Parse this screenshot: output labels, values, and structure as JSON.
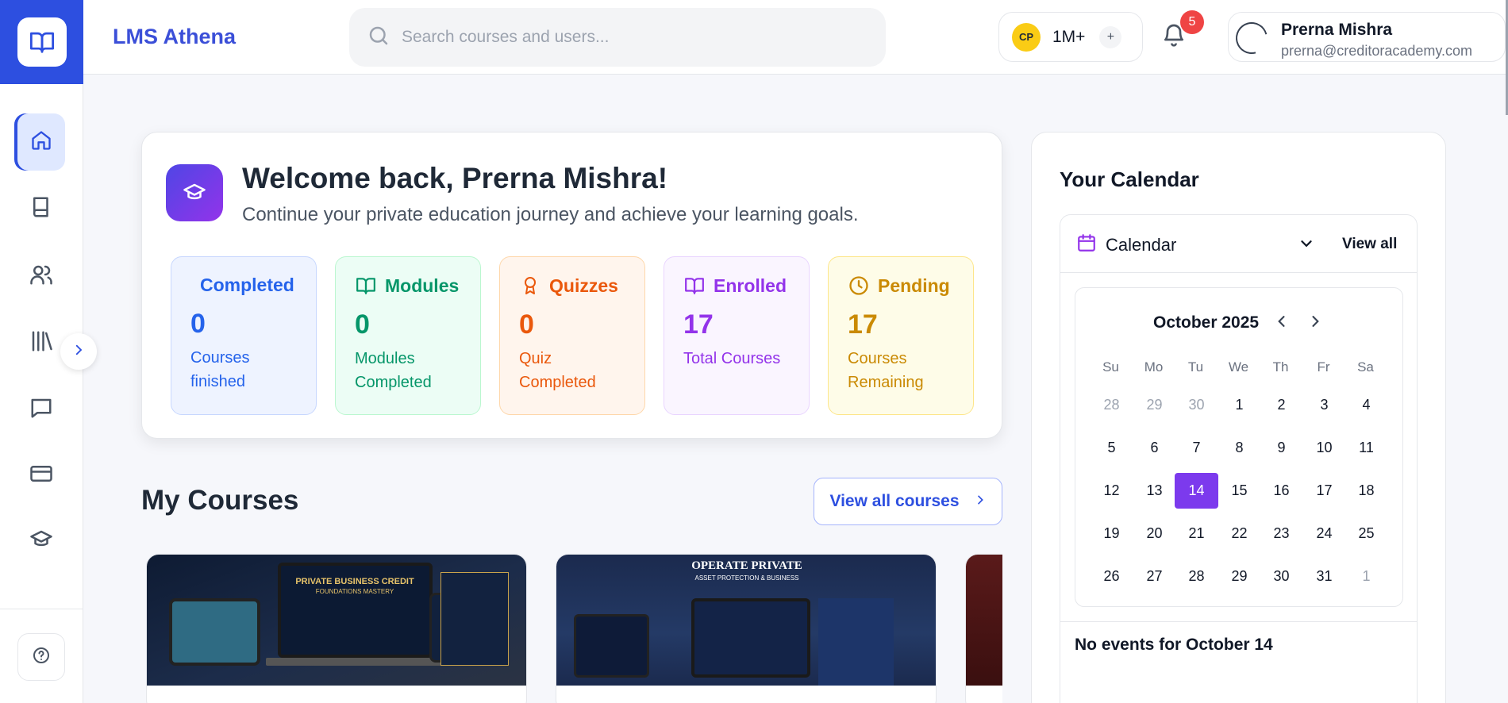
{
  "app": {
    "brand": "LMS Athena"
  },
  "search": {
    "placeholder": "Search courses and users..."
  },
  "points": {
    "badge": "CP",
    "value": "1M+",
    "add": "+"
  },
  "notifications": {
    "count": "5"
  },
  "user": {
    "name": "Prerna Mishra",
    "email": "prerna@creditoracademy.com"
  },
  "sidebar": {
    "items": [
      {
        "name": "home",
        "icon": "home-icon",
        "active": true
      },
      {
        "name": "courses",
        "icon": "book-icon"
      },
      {
        "name": "users",
        "icon": "users-icon"
      },
      {
        "name": "library",
        "icon": "library-icon"
      },
      {
        "name": "messages",
        "icon": "message-icon"
      },
      {
        "name": "billing",
        "icon": "credit-card-icon"
      },
      {
        "name": "academy",
        "icon": "graduation-cap-icon"
      }
    ],
    "help_icon": "help-icon"
  },
  "welcome": {
    "title": "Welcome back, Prerna Mishra!",
    "subtitle": "Continue your private education journey and achieve your learning goals."
  },
  "stats": [
    {
      "title": "Completed",
      "value": "0",
      "label": "Courses finished",
      "color": "#2563eb",
      "bg": "#eef3ff",
      "border": "#c7d7fe",
      "icon": "none"
    },
    {
      "title": "Modules",
      "value": "0",
      "label": "Modules Completed",
      "color": "#059669",
      "bg": "#ecfdf5",
      "border": "#bbf7d0",
      "icon": "book-open-icon"
    },
    {
      "title": "Quizzes",
      "value": "0",
      "label": "Quiz Completed",
      "color": "#ea580c",
      "bg": "#fff5ed",
      "border": "#fed7aa",
      "icon": "award-icon"
    },
    {
      "title": "Enrolled",
      "value": "17",
      "label": "Total Courses",
      "color": "#9333ea",
      "bg": "#faf5ff",
      "border": "#e9d5ff",
      "icon": "book-open-icon"
    },
    {
      "title": "Pending",
      "value": "17",
      "label": "Courses Remaining",
      "color": "#ca8a04",
      "bg": "#fefce8",
      "border": "#fde68a",
      "icon": "clock-icon"
    }
  ],
  "courses": {
    "title": "My Courses",
    "view_all": "View all courses",
    "cards": [
      {
        "image_title": "PRIVATE BUSINESS CREDIT",
        "image_subtitle": "FOUNDATIONS MASTERY"
      },
      {
        "image_title": "OPERATE PRIVATE",
        "image_subtitle": "ASSET PROTECTION & BUSINESS"
      },
      {
        "image_title": "",
        "image_subtitle": ""
      }
    ]
  },
  "calendar": {
    "title": "Your Calendar",
    "label": "Calendar",
    "view_all": "View all",
    "month": "October 2025",
    "weekdays": [
      "Su",
      "Mo",
      "Tu",
      "We",
      "Th",
      "Fr",
      "Sa"
    ],
    "weeks": [
      [
        "28",
        "29",
        "30",
        "1",
        "2",
        "3",
        "4"
      ],
      [
        "5",
        "6",
        "7",
        "8",
        "9",
        "10",
        "11"
      ],
      [
        "12",
        "13",
        "14",
        "15",
        "16",
        "17",
        "18"
      ],
      [
        "19",
        "20",
        "21",
        "22",
        "23",
        "24",
        "25"
      ],
      [
        "26",
        "27",
        "28",
        "29",
        "30",
        "31",
        "1"
      ]
    ],
    "selected_day": "14",
    "no_events": "No events for October 14"
  }
}
